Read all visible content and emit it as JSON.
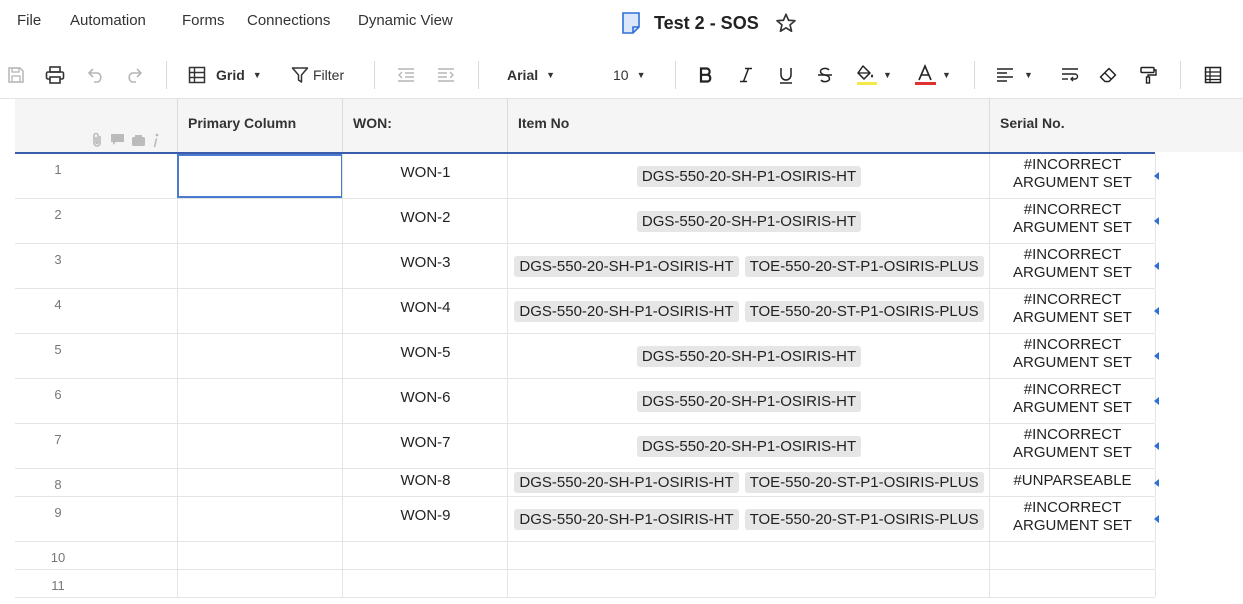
{
  "menu": [
    "File",
    "Automation",
    "Forms",
    "Connections",
    "Dynamic View"
  ],
  "sheet_title": "Test 2 - SOS",
  "toolbar": {
    "view_label": "Grid",
    "filter_label": "Filter",
    "font": "Arial",
    "font_size": "10"
  },
  "columns": [
    "Primary Column",
    "WON:",
    "Item No",
    "Serial No."
  ],
  "rows": [
    {
      "num": "1",
      "won": "WON-1",
      "items": [
        "DGS-550-20-SH-P1-OSIRIS-HT"
      ],
      "serial": [
        "#INCORRECT",
        "ARGUMENT SET"
      ]
    },
    {
      "num": "2",
      "won": "WON-2",
      "items": [
        "DGS-550-20-SH-P1-OSIRIS-HT"
      ],
      "serial": [
        "#INCORRECT",
        "ARGUMENT SET"
      ]
    },
    {
      "num": "3",
      "won": "WON-3",
      "items": [
        "DGS-550-20-SH-P1-OSIRIS-HT",
        "TOE-550-20-ST-P1-OSIRIS-PLUS"
      ],
      "serial": [
        "#INCORRECT",
        "ARGUMENT SET"
      ]
    },
    {
      "num": "4",
      "won": "WON-4",
      "items": [
        "DGS-550-20-SH-P1-OSIRIS-HT",
        "TOE-550-20-ST-P1-OSIRIS-PLUS"
      ],
      "serial": [
        "#INCORRECT",
        "ARGUMENT SET"
      ]
    },
    {
      "num": "5",
      "won": "WON-5",
      "items": [
        "DGS-550-20-SH-P1-OSIRIS-HT"
      ],
      "serial": [
        "#INCORRECT",
        "ARGUMENT SET"
      ]
    },
    {
      "num": "6",
      "won": "WON-6",
      "items": [
        "DGS-550-20-SH-P1-OSIRIS-HT"
      ],
      "serial": [
        "#INCORRECT",
        "ARGUMENT SET"
      ]
    },
    {
      "num": "7",
      "won": "WON-7",
      "items": [
        "DGS-550-20-SH-P1-OSIRIS-HT"
      ],
      "serial": [
        "#INCORRECT",
        "ARGUMENT SET"
      ]
    },
    {
      "num": "8",
      "won": "WON-8",
      "items": [
        "DGS-550-20-SH-P1-OSIRIS-HT",
        "TOE-550-20-ST-P1-OSIRIS-PLUS"
      ],
      "serial": [
        "#UNPARSEABLE"
      ]
    },
    {
      "num": "9",
      "won": "WON-9",
      "items": [
        "DGS-550-20-SH-P1-OSIRIS-HT",
        "TOE-550-20-ST-P1-OSIRIS-PLUS"
      ],
      "serial": [
        "#INCORRECT",
        "ARGUMENT SET"
      ]
    },
    {
      "num": "10",
      "won": "",
      "items": [],
      "serial": []
    },
    {
      "num": "11",
      "won": "",
      "items": [],
      "serial": []
    }
  ],
  "colors": {
    "accent": "#3b5bab",
    "selection": "#4a7bd1",
    "tag_bg": "#e6e6e6",
    "highlight_bar": "#f5e94a",
    "text_color_bar": "#e03131"
  }
}
